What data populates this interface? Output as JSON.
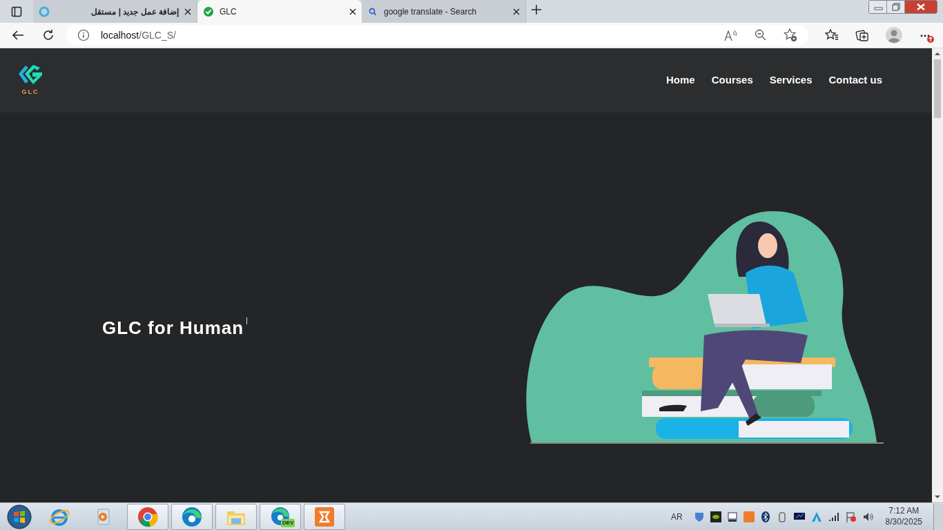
{
  "browser": {
    "tabs": [
      {
        "kind": "ring",
        "title": "إضافة عمل جديد | مستقل",
        "selected": false
      },
      {
        "kind": "check",
        "title": "GLC",
        "selected": true
      },
      {
        "kind": "search",
        "title": "google translate - Search",
        "selected": false
      }
    ],
    "address": {
      "host": "localhost",
      "path": "/GLC_S/"
    }
  },
  "site": {
    "logo_text": "GLC",
    "nav": [
      {
        "label": "Home"
      },
      {
        "label": "Courses"
      },
      {
        "label": "Services"
      },
      {
        "label": "Contact us"
      }
    ],
    "hero": {
      "title": "GLC for Human"
    }
  },
  "taskbar": {
    "apps": [
      {
        "kind": "ie",
        "running": false
      },
      {
        "kind": "media",
        "running": false
      },
      {
        "kind": "chrome",
        "running": true
      },
      {
        "kind": "edge",
        "running": true
      },
      {
        "kind": "explorer",
        "running": true
      },
      {
        "kind": "edgedev",
        "running": true,
        "badge": "DEV"
      },
      {
        "kind": "xampp",
        "running": true
      }
    ],
    "language": "AR",
    "time": "7:12 AM",
    "date": "8/30/2025"
  }
}
